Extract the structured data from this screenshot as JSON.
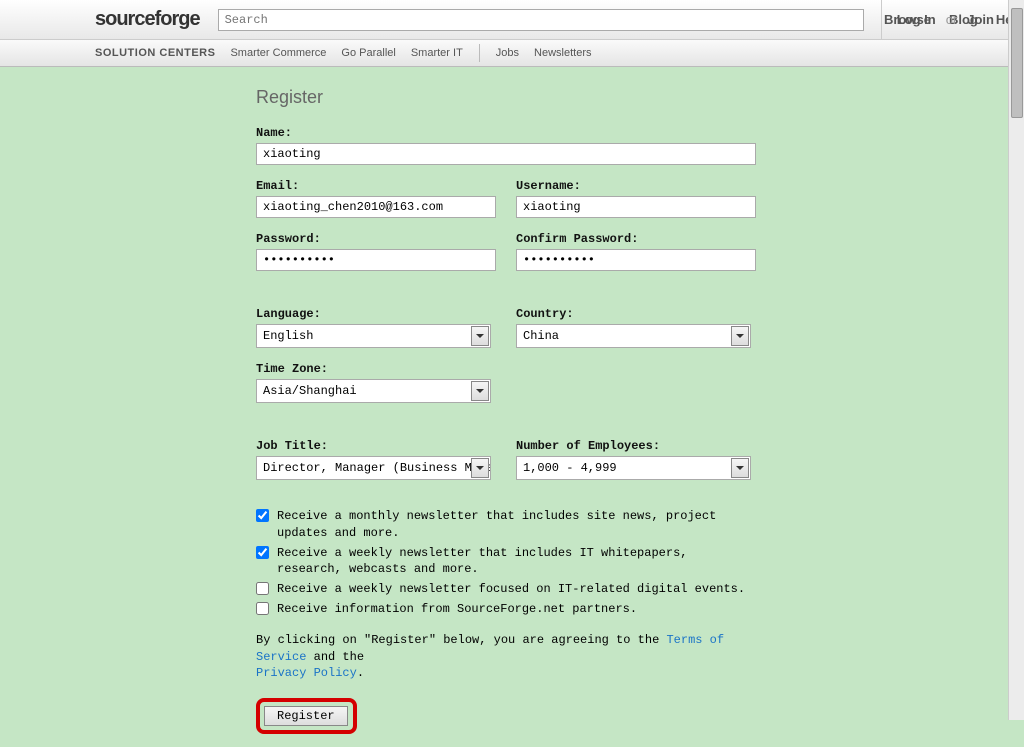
{
  "topbar": {
    "logo": "sourceforge",
    "search_placeholder": "Search",
    "links": {
      "browse": "Browse",
      "blog": "Blog",
      "help": "Help"
    },
    "login": "Log In",
    "or": "or",
    "join": "Join"
  },
  "subbar": {
    "solution": "SOLUTION CENTERS",
    "smarter_commerce": "Smarter Commerce",
    "go_parallel": "Go Parallel",
    "smarter_it": "Smarter IT",
    "jobs": "Jobs",
    "newsletters": "Newsletters"
  },
  "page": {
    "title": "Register",
    "labels": {
      "name": "Name:",
      "email": "Email:",
      "username": "Username:",
      "password": "Password:",
      "confirm_password": "Confirm Password:",
      "language": "Language:",
      "country": "Country:",
      "time_zone": "Time Zone:",
      "job_title": "Job Title:",
      "num_employees": "Number of Employees:"
    },
    "values": {
      "name": "xiaoting",
      "email": "xiaoting_chen2010@163.com",
      "username": "xiaoting",
      "password": "••••••••••",
      "confirm_password": "••••••••••",
      "language": "English",
      "country": "China",
      "time_zone": "Asia/Shanghai",
      "job_title": "Director, Manager (Business Managemen",
      "num_employees": "1,000 - 4,999"
    },
    "checks": {
      "monthly": "Receive a monthly newsletter that includes site news, project updates and more.",
      "weekly_it": "Receive a weekly newsletter that includes IT whitepapers, research, webcasts and more.",
      "weekly_events": "Receive a weekly newsletter focused on IT-related digital events.",
      "partners": "Receive information from SourceForge.net partners."
    },
    "agree": {
      "pre": "By clicking on \"Register\" below, you are agreeing to the ",
      "tos": "Terms of Service",
      "mid": " and the ",
      "privacy": "Privacy Policy",
      "end": "."
    },
    "register_btn": "Register"
  }
}
